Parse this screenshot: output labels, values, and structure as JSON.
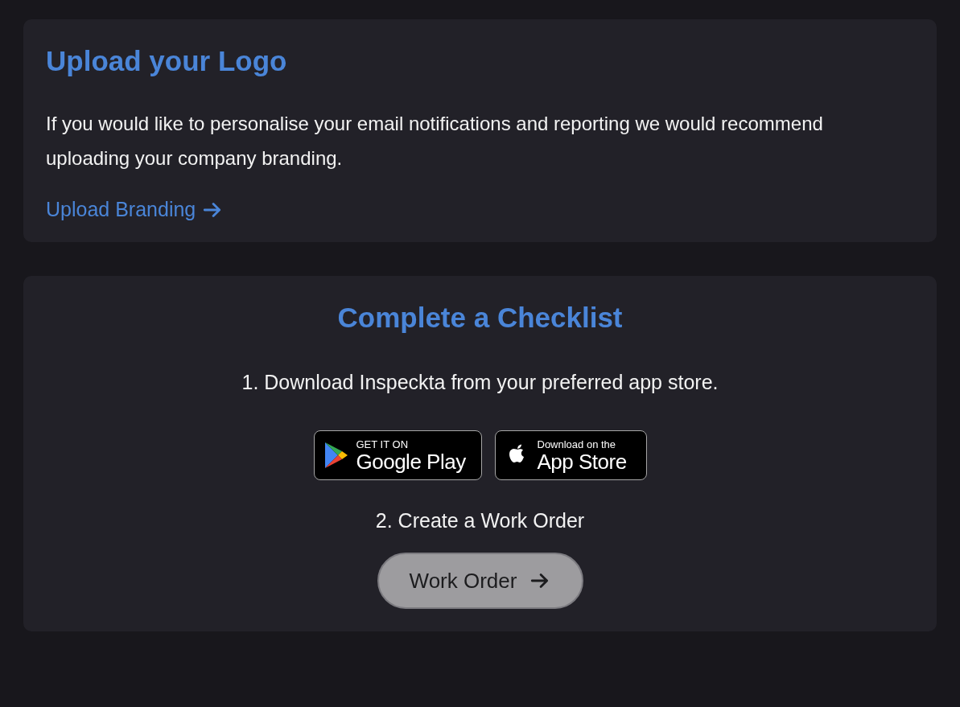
{
  "upload_logo": {
    "title": "Upload your Logo",
    "description": "If you would like to personalise your email notifications and reporting we would recommend uploading your company branding.",
    "link": "Upload Branding"
  },
  "checklist": {
    "title": "Complete a Checklist",
    "step_1": "1. Download Inspeckta from your preferred app store.",
    "store_badges": [
      {
        "kind": "google",
        "small_text": "GET IT ON",
        "large_text": "Google Play"
      },
      {
        "kind": "apple",
        "small_text": "Download on the",
        "large_text": "App Store"
      }
    ],
    "step_2": "2. Create a Work Order",
    "button": "Work Order"
  }
}
